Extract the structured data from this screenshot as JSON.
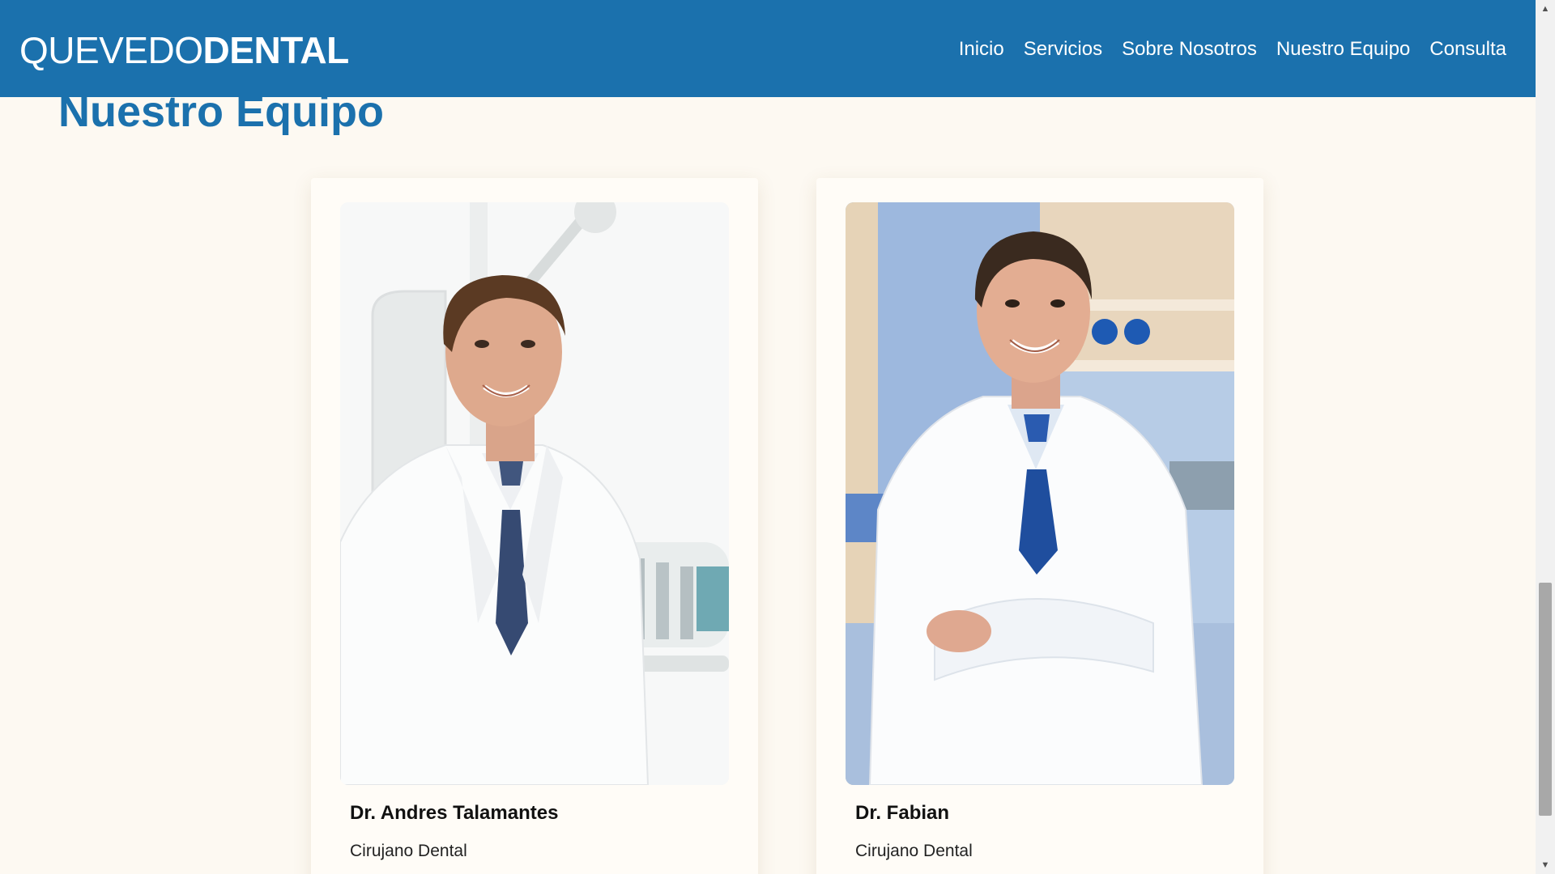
{
  "brand": {
    "light": "QUEVEDO",
    "bold": "DENTAL"
  },
  "nav": {
    "items": [
      {
        "label": "Inicio"
      },
      {
        "label": "Servicios"
      },
      {
        "label": "Sobre Nosotros"
      },
      {
        "label": "Nuestro Equipo"
      },
      {
        "label": "Consulta"
      }
    ]
  },
  "section": {
    "title": "Nuestro Equipo"
  },
  "team": [
    {
      "name": "Dr. Andres Talamantes",
      "role": "Cirujano Dental"
    },
    {
      "name": "Dr. Fabian",
      "role": "Cirujano Dental"
    }
  ],
  "colors": {
    "primary": "#1b71ad",
    "background": "#fdf9f2",
    "card": "#fffcf7"
  },
  "scrollbar": {
    "up_icon": "chevron-up-icon",
    "down_icon": "chevron-down-icon"
  }
}
